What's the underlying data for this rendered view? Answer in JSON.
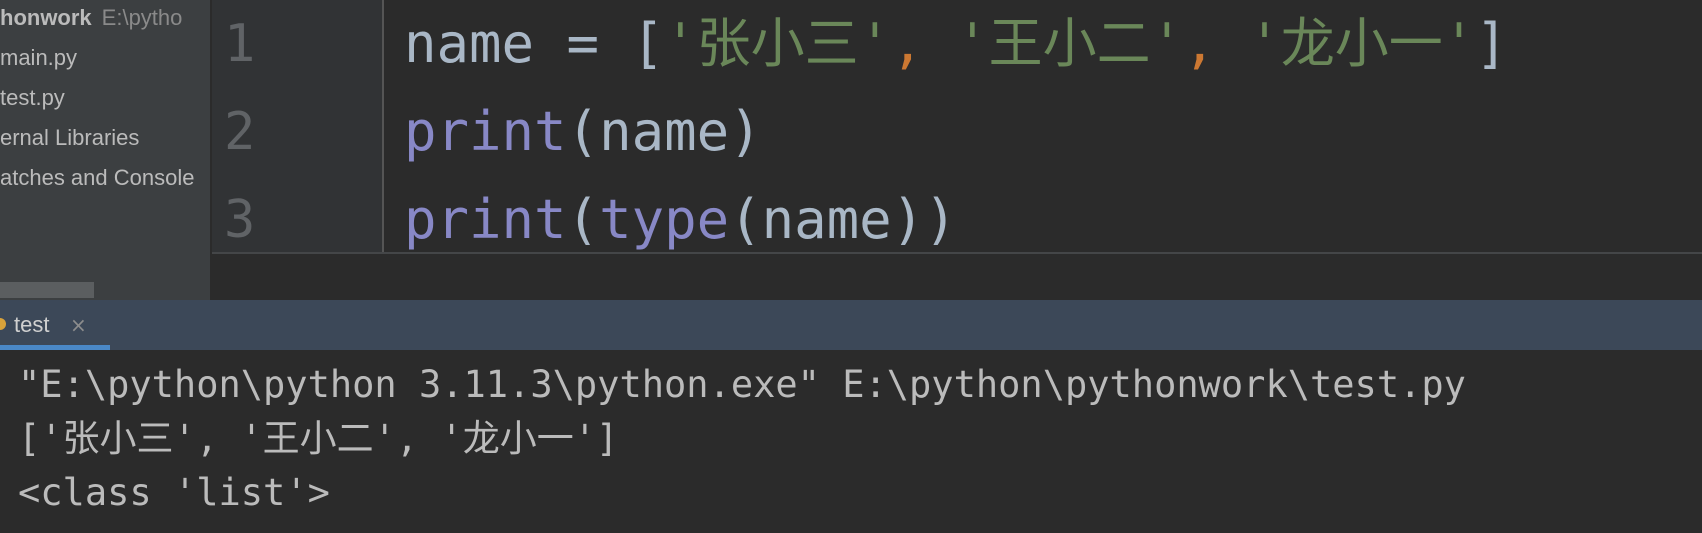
{
  "project": {
    "root_name": "honwork",
    "root_path": "E:\\pytho",
    "items": [
      "main.py",
      "test.py",
      "ernal Libraries",
      "atches and Console"
    ]
  },
  "editor": {
    "lines": [
      {
        "number": "1",
        "tokens": [
          {
            "text": "name = ",
            "cls": "t-br"
          },
          {
            "text": "[",
            "cls": "t-br"
          },
          {
            "text": "'张小三'",
            "cls": "t-str"
          },
          {
            "text": ", ",
            "cls": "t-comma"
          },
          {
            "text": "'王小二'",
            "cls": "t-str"
          },
          {
            "text": ", ",
            "cls": "t-comma"
          },
          {
            "text": "'龙小一'",
            "cls": "t-str"
          },
          {
            "text": "]",
            "cls": "t-br"
          }
        ]
      },
      {
        "number": "2",
        "tokens": [
          {
            "text": "print",
            "cls": "t-fn"
          },
          {
            "text": "(name)",
            "cls": "t-br"
          }
        ]
      },
      {
        "number": "3",
        "tokens": [
          {
            "text": "print",
            "cls": "t-fn"
          },
          {
            "text": "(",
            "cls": "t-br"
          },
          {
            "text": "type",
            "cls": "t-fn"
          },
          {
            "text": "(name))",
            "cls": "t-br"
          }
        ]
      }
    ]
  },
  "run": {
    "tab_label": "test",
    "tab_close": "×",
    "console_lines": [
      "\"E:\\python\\python 3.11.3\\python.exe\" E:\\python\\pythonwork\\test.py",
      "['张小三', '王小二', '龙小一']",
      "<class 'list'>"
    ]
  },
  "colors": {
    "keyword_fn": "#8888c6",
    "string": "#6a8759",
    "comma": "#cc7832",
    "tab_underline": "#4a88c7"
  }
}
